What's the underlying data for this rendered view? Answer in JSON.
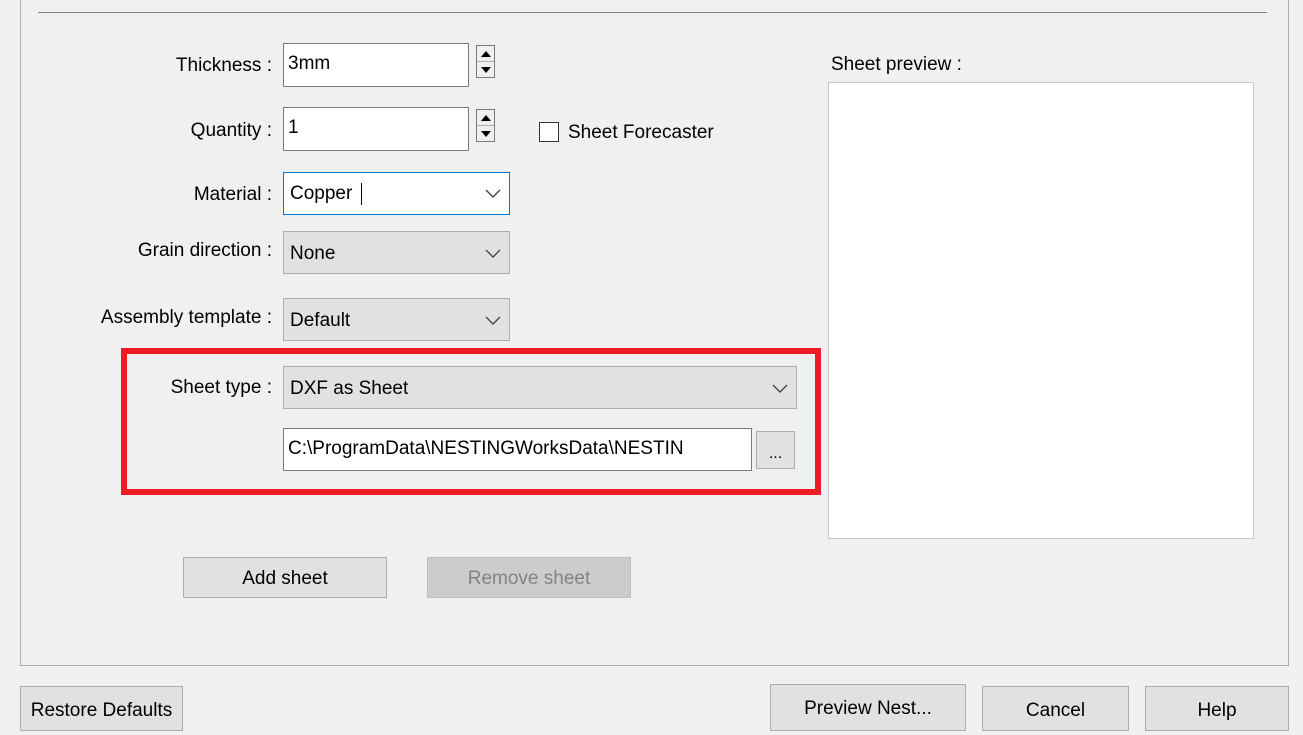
{
  "form": {
    "thickness": {
      "label": "Thickness :",
      "value": "3mm"
    },
    "quantity": {
      "label": "Quantity :",
      "value": "1"
    },
    "sheet_forecaster": {
      "label": "Sheet Forecaster",
      "checked": false
    },
    "material": {
      "label": "Material :",
      "value": "Copper"
    },
    "grain_direction": {
      "label": "Grain direction :",
      "value": "None"
    },
    "assembly_template": {
      "label": "Assembly template :",
      "value": "Default"
    },
    "sheet_type": {
      "label": "Sheet type :",
      "value": "DXF as Sheet"
    },
    "sheet_path": {
      "value": "C:\\ProgramData\\NESTINGWorksData\\NESTIN"
    },
    "browse_label": "..."
  },
  "preview": {
    "label": "Sheet preview :"
  },
  "buttons": {
    "add_sheet": "Add sheet",
    "remove_sheet": "Remove sheet",
    "restore_defaults": "Restore Defaults",
    "preview_nest": "Preview Nest...",
    "cancel": "Cancel",
    "help": "Help"
  },
  "colors": {
    "highlight": "#ed1c24",
    "focus": "#0078d7",
    "background": "#f0f0f0"
  },
  "icons": {
    "spin_up": "up-triangle",
    "spin_down": "down-triangle",
    "dropdown": "chevron-down"
  }
}
